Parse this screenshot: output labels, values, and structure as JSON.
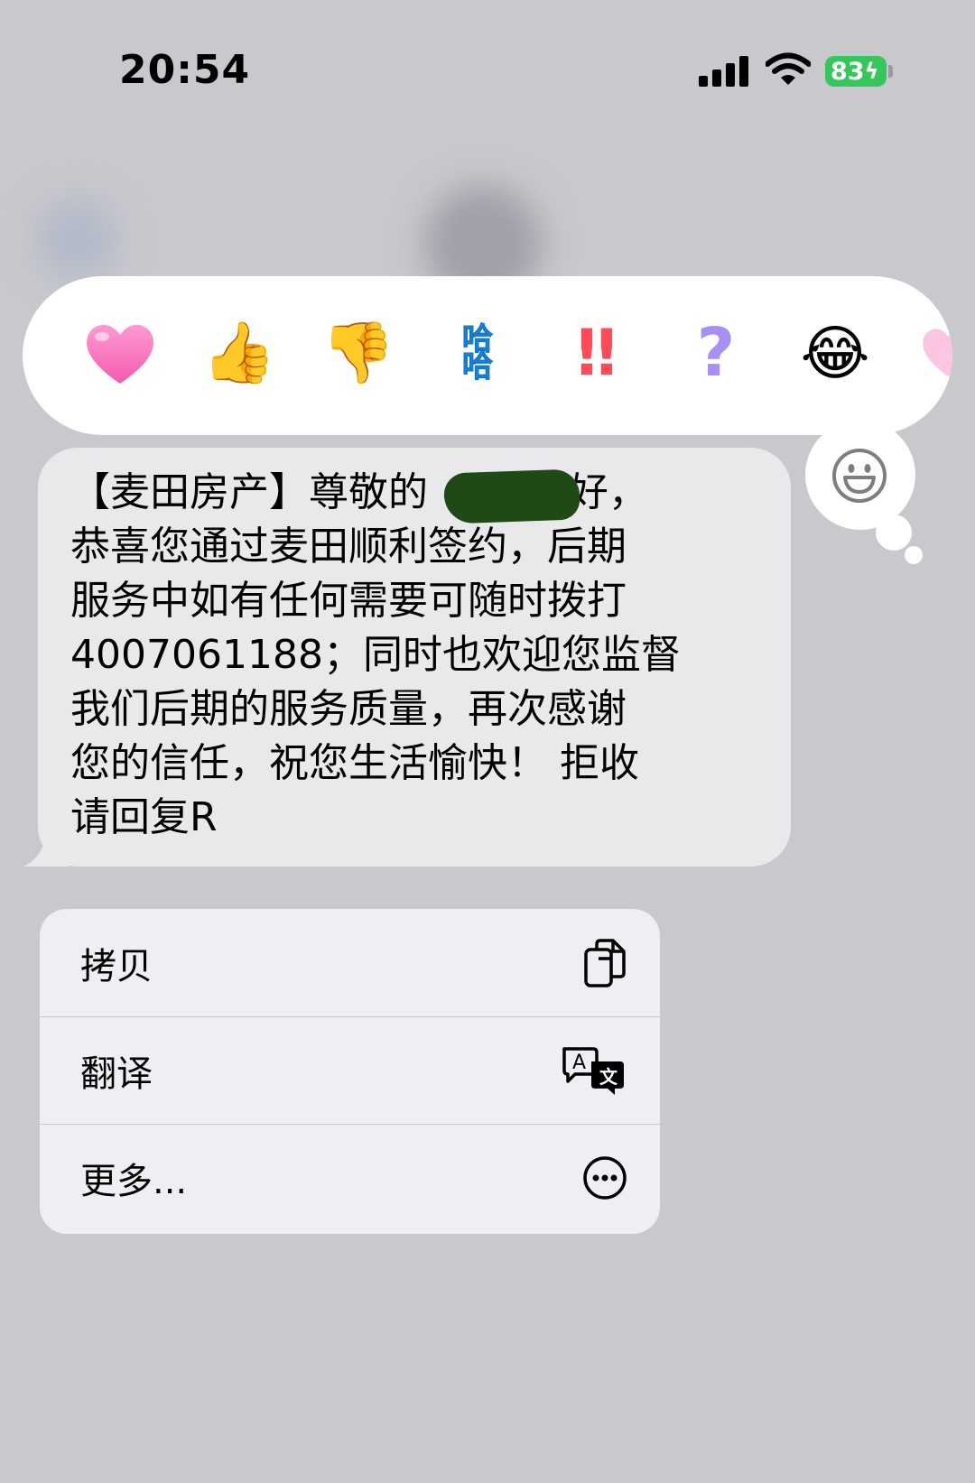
{
  "status_bar": {
    "time": "20:54",
    "battery_level": "83",
    "battery_color": "#34c759"
  },
  "reactions": [
    {
      "name": "heart",
      "glyph": "heart"
    },
    {
      "name": "thumbs-up",
      "glyph": "👍"
    },
    {
      "name": "thumbs-down",
      "glyph": "👎"
    },
    {
      "name": "haha",
      "glyph": "哈哈"
    },
    {
      "name": "exclamation",
      "glyph": "‼"
    },
    {
      "name": "question",
      "glyph": "?"
    },
    {
      "name": "tears-of-joy",
      "glyph": "😂"
    }
  ],
  "message": {
    "text": "【麦田房产】尊敬的        您好，\n恭喜您通过麦田顺利签约，后期\n服务中如有任何需要可随时拨打\n4007061188；同时也欢迎您监督\n我们后期的服务质量，再次感谢\n您的信任，祝您生活愉快！ 拒收\n请回复R",
    "bubble_color": "#e9e9eb"
  },
  "context_menu": {
    "items": [
      {
        "label": "拷贝",
        "icon": "copy-icon"
      },
      {
        "label": "翻译",
        "icon": "translate-icon"
      },
      {
        "label": "更多...",
        "icon": "more-icon"
      }
    ]
  }
}
